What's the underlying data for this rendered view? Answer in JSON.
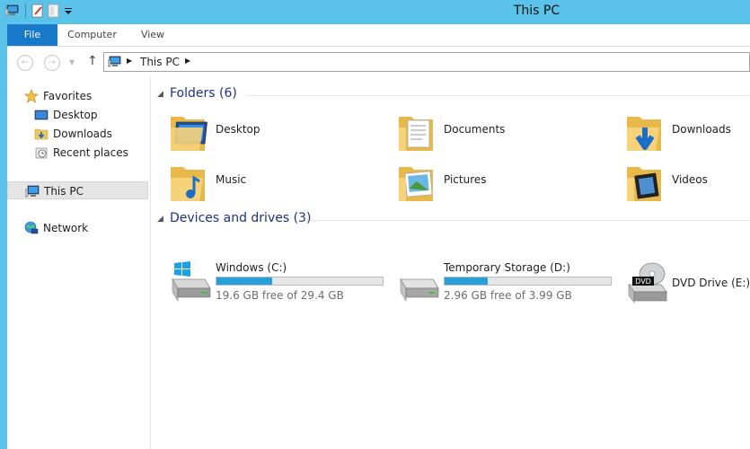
{
  "window": {
    "title": "This PC"
  },
  "ribbon": {
    "tabs": [
      {
        "label": "File"
      },
      {
        "label": "Computer"
      },
      {
        "label": "View"
      }
    ]
  },
  "address": {
    "crumbs": [
      {
        "label": "This PC"
      }
    ]
  },
  "nav": {
    "favorites": {
      "label": "Favorites",
      "icon": "star-icon"
    },
    "favorites_items": [
      {
        "label": "Desktop",
        "icon": "desktop-icon"
      },
      {
        "label": "Downloads",
        "icon": "downloads-icon"
      },
      {
        "label": "Recent places",
        "icon": "recent-places-icon"
      }
    ],
    "this_pc": {
      "label": "This PC",
      "icon": "computer-icon"
    },
    "network": {
      "label": "Network",
      "icon": "network-icon"
    }
  },
  "folders": {
    "heading": "Folders (6)",
    "items": [
      {
        "label": "Desktop",
        "icon": "desktop-folder-icon"
      },
      {
        "label": "Documents",
        "icon": "documents-folder-icon"
      },
      {
        "label": "Downloads",
        "icon": "downloads-folder-icon"
      },
      {
        "label": "Music",
        "icon": "music-folder-icon"
      },
      {
        "label": "Pictures",
        "icon": "pictures-folder-icon"
      },
      {
        "label": "Videos",
        "icon": "videos-folder-icon"
      }
    ]
  },
  "devices": {
    "heading": "Devices and drives (3)",
    "items": [
      {
        "label": "Windows (C:)",
        "free_text": "19.6 GB free of 29.4 GB",
        "used_fraction": 0.333,
        "icon": "windows-drive-icon"
      },
      {
        "label": "Temporary Storage (D:)",
        "free_text": "2.96 GB free of 3.99 GB",
        "used_fraction": 0.258,
        "icon": "hard-drive-icon"
      },
      {
        "label": "DVD Drive (E:)",
        "icon": "dvd-drive-icon",
        "badge": "DVD"
      }
    ]
  },
  "colors": {
    "accent": "#1979ca",
    "titlebar": "#5bc3ea",
    "heading": "#1e3287",
    "bar_fill": "#26a0da"
  }
}
